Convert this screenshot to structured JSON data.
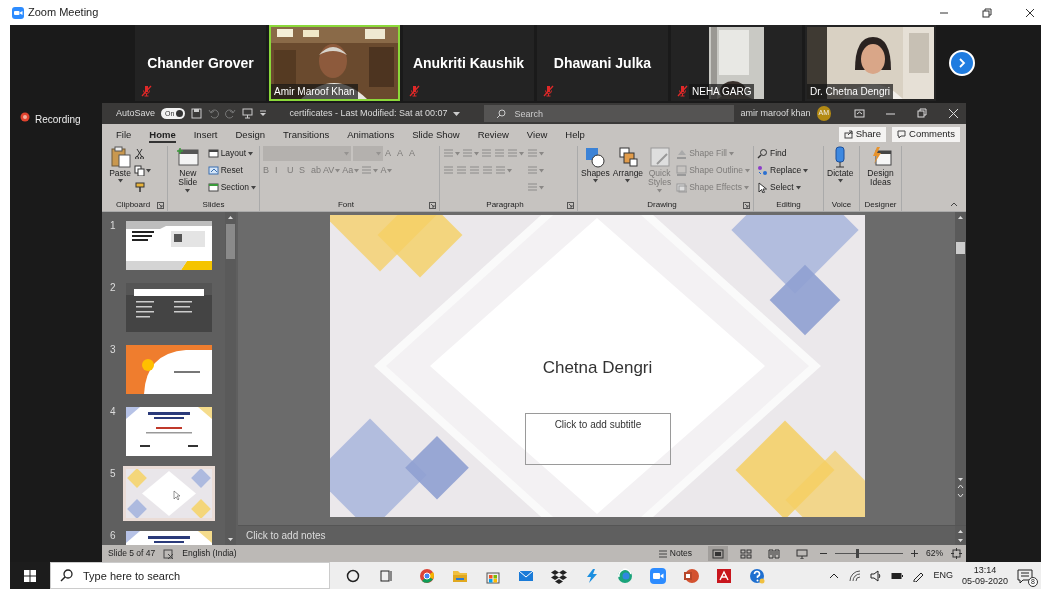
{
  "window": {
    "title": "Zoom Meeting"
  },
  "participants": [
    {
      "name": "Chander Grover",
      "kind": "name",
      "muted": true,
      "speaking": false
    },
    {
      "name": "Amir Maroof Khan",
      "kind": "video",
      "muted": false,
      "speaking": true
    },
    {
      "name": "Anukriti Kaushik",
      "kind": "name",
      "muted": true,
      "speaking": false
    },
    {
      "name": "Dhawani Julka",
      "kind": "name",
      "muted": true,
      "speaking": false
    },
    {
      "name": "NEHA GARG",
      "kind": "narrow-video",
      "muted": true,
      "speaking": false
    },
    {
      "name": "Dr. Chetna Dengri",
      "kind": "video",
      "muted": false,
      "speaking": false
    }
  ],
  "recording": "Recording",
  "powerpoint": {
    "autosave": {
      "label": "AutoSave",
      "state": "On",
      "on": true
    },
    "file_title": "certificates - Last Modified: Sat at 00:07",
    "search": {
      "placeholder": "Search"
    },
    "user": {
      "name": "amir maroof khan",
      "initials": "AM"
    },
    "tabs": [
      {
        "label": "File",
        "selected": false
      },
      {
        "label": "Home",
        "selected": true
      },
      {
        "label": "Insert",
        "selected": false
      },
      {
        "label": "Design",
        "selected": false
      },
      {
        "label": "Transitions",
        "selected": false
      },
      {
        "label": "Animations",
        "selected": false
      },
      {
        "label": "Slide Show",
        "selected": false
      },
      {
        "label": "Review",
        "selected": false
      },
      {
        "label": "View",
        "selected": false
      },
      {
        "label": "Help",
        "selected": false
      }
    ],
    "share": "Share",
    "comments": "Comments",
    "ribbon_groups": [
      {
        "label": "Clipboard",
        "launcher": true,
        "columns": [
          [
            [
              {
                "kind": "large",
                "label": "Paste",
                "dropdown": true,
                "disabled": false
              }
            ]
          ],
          [
            [
              {
                "kind": "icon",
                "dropdown": false,
                "disabled": false
              }
            ],
            [
              {
                "kind": "icon",
                "dropdown": true,
                "disabled": false
              }
            ],
            [
              {
                "kind": "icon",
                "dropdown": false,
                "disabled": false
              }
            ]
          ]
        ]
      },
      {
        "label": "Slides",
        "launcher": false,
        "columns": [
          [
            [
              {
                "kind": "large",
                "label": "New Slide",
                "dropdown": true,
                "disabled": false
              }
            ]
          ],
          [
            [
              {
                "kind": "small",
                "label": "Layout",
                "dropdown": true,
                "disabled": false
              }
            ],
            [
              {
                "kind": "small",
                "label": "Reset",
                "dropdown": false,
                "disabled": false
              }
            ],
            [
              {
                "kind": "small",
                "label": "Section",
                "dropdown": true,
                "disabled": false
              }
            ]
          ]
        ]
      },
      {
        "label": "Font",
        "launcher": true,
        "columns": [
          [
            [
              {
                "kind": "fontbox",
                "dropdown": true,
                "disabled": true
              },
              {
                "kind": "sizebox",
                "dropdown": true,
                "disabled": true
              },
              {
                "kind": "glyph",
                "label": "A",
                "dropdown": false,
                "disabled": true
              },
              {
                "kind": "glyph",
                "label": "A",
                "dropdown": false,
                "disabled": true
              },
              {
                "kind": "glyph",
                "label": "A",
                "dropdown": false,
                "disabled": true
              }
            ],
            [
              {
                "kind": "glyph",
                "label": "B",
                "dropdown": false,
                "disabled": true
              },
              {
                "kind": "glyph",
                "label": "I",
                "dropdown": false,
                "disabled": true
              },
              {
                "kind": "glyph",
                "label": "U",
                "dropdown": false,
                "disabled": true
              },
              {
                "kind": "glyph",
                "label": "S",
                "dropdown": false,
                "disabled": true
              },
              {
                "kind": "glyph",
                "label": "ab",
                "dropdown": false,
                "disabled": true
              },
              {
                "kind": "glyph",
                "label": "AV",
                "dropdown": true,
                "disabled": true
              },
              {
                "kind": "glyph",
                "label": "Aa",
                "dropdown": true,
                "disabled": true
              },
              {
                "kind": "icon",
                "dropdown": true,
                "disabled": true
              },
              {
                "kind": "glyph",
                "label": "A",
                "dropdown": true,
                "disabled": true
              }
            ]
          ]
        ]
      },
      {
        "label": "Paragraph",
        "launcher": true,
        "columns": [
          [
            [
              {
                "kind": "icon",
                "dropdown": true,
                "disabled": true
              },
              {
                "kind": "icon",
                "dropdown": true,
                "disabled": true
              },
              {
                "kind": "icon",
                "dropdown": false,
                "disabled": true
              },
              {
                "kind": "icon",
                "dropdown": false,
                "disabled": true
              },
              {
                "kind": "icon",
                "dropdown": true,
                "disabled": true
              }
            ],
            [
              {
                "kind": "icon",
                "dropdown": false,
                "disabled": true
              },
              {
                "kind": "icon",
                "dropdown": false,
                "disabled": true
              },
              {
                "kind": "icon",
                "dropdown": false,
                "disabled": true
              },
              {
                "kind": "icon",
                "dropdown": false,
                "disabled": true
              },
              {
                "kind": "icon",
                "dropdown": true,
                "disabled": true
              }
            ]
          ],
          [
            [
              {
                "kind": "icon",
                "dropdown": true,
                "disabled": true
              }
            ],
            [
              {
                "kind": "icon",
                "dropdown": true,
                "disabled": true
              }
            ],
            [
              {
                "kind": "icon",
                "dropdown": true,
                "disabled": true
              }
            ]
          ]
        ]
      },
      {
        "label": "Drawing",
        "launcher": true,
        "columns": [
          [
            [
              {
                "kind": "large",
                "label": "Shapes",
                "dropdown": true,
                "disabled": false
              }
            ]
          ],
          [
            [
              {
                "kind": "large",
                "label": "Arrange",
                "dropdown": true,
                "disabled": false
              }
            ]
          ],
          [
            [
              {
                "kind": "large",
                "label": "Quick Styles",
                "dropdown": true,
                "disabled": true
              }
            ]
          ],
          [
            [
              {
                "kind": "small",
                "label": "Shape Fill",
                "dropdown": true,
                "disabled": true
              }
            ],
            [
              {
                "kind": "small",
                "label": "Shape Outline",
                "dropdown": true,
                "disabled": true
              }
            ],
            [
              {
                "kind": "small",
                "label": "Shape Effects",
                "dropdown": true,
                "disabled": true
              }
            ]
          ]
        ]
      },
      {
        "label": "Editing",
        "launcher": false,
        "columns": [
          [
            [
              {
                "kind": "small",
                "label": "Find",
                "dropdown": false,
                "disabled": false
              }
            ],
            [
              {
                "kind": "small",
                "label": "Replace",
                "dropdown": true,
                "disabled": false
              }
            ],
            [
              {
                "kind": "small",
                "label": "Select",
                "dropdown": true,
                "disabled": false
              }
            ]
          ]
        ]
      },
      {
        "label": "Voice",
        "launcher": false,
        "columns": [
          [
            [
              {
                "kind": "large",
                "label": "Dictate",
                "dropdown": true,
                "disabled": false
              }
            ]
          ]
        ]
      },
      {
        "label": "Designer",
        "launcher": false,
        "columns": [
          [
            [
              {
                "kind": "large",
                "label": "Design Ideas",
                "dropdown": false,
                "disabled": false
              }
            ]
          ]
        ]
      }
    ],
    "slides": [
      {
        "number": "1",
        "kind": "title-photo",
        "selected": false
      },
      {
        "number": "2",
        "kind": "dark-list",
        "selected": false
      },
      {
        "number": "3",
        "kind": "orange",
        "selected": false
      },
      {
        "number": "4",
        "kind": "certificate",
        "selected": false
      },
      {
        "number": "5",
        "kind": "geometric",
        "selected": true
      },
      {
        "number": "6",
        "kind": "certificate",
        "selected": false
      }
    ],
    "slide": {
      "title": "Chetna Dengri",
      "subtitle_placeholder": "Click to add subtitle"
    },
    "notes_placeholder": "Click to add notes",
    "status_bar": {
      "slide": "Slide 5 of 47",
      "language": "English (India)",
      "notes": "Notes",
      "views": [
        {
          "selected": true
        },
        {
          "selected": false
        },
        {
          "selected": false
        },
        {
          "selected": false
        }
      ],
      "zoom": {
        "level": 0.31,
        "reading": "62%"
      }
    }
  },
  "taskbar": {
    "search_placeholder": "Type here to search",
    "language": "ENG",
    "time": "13:14",
    "date": "05-09-2020",
    "notifications": "8"
  }
}
